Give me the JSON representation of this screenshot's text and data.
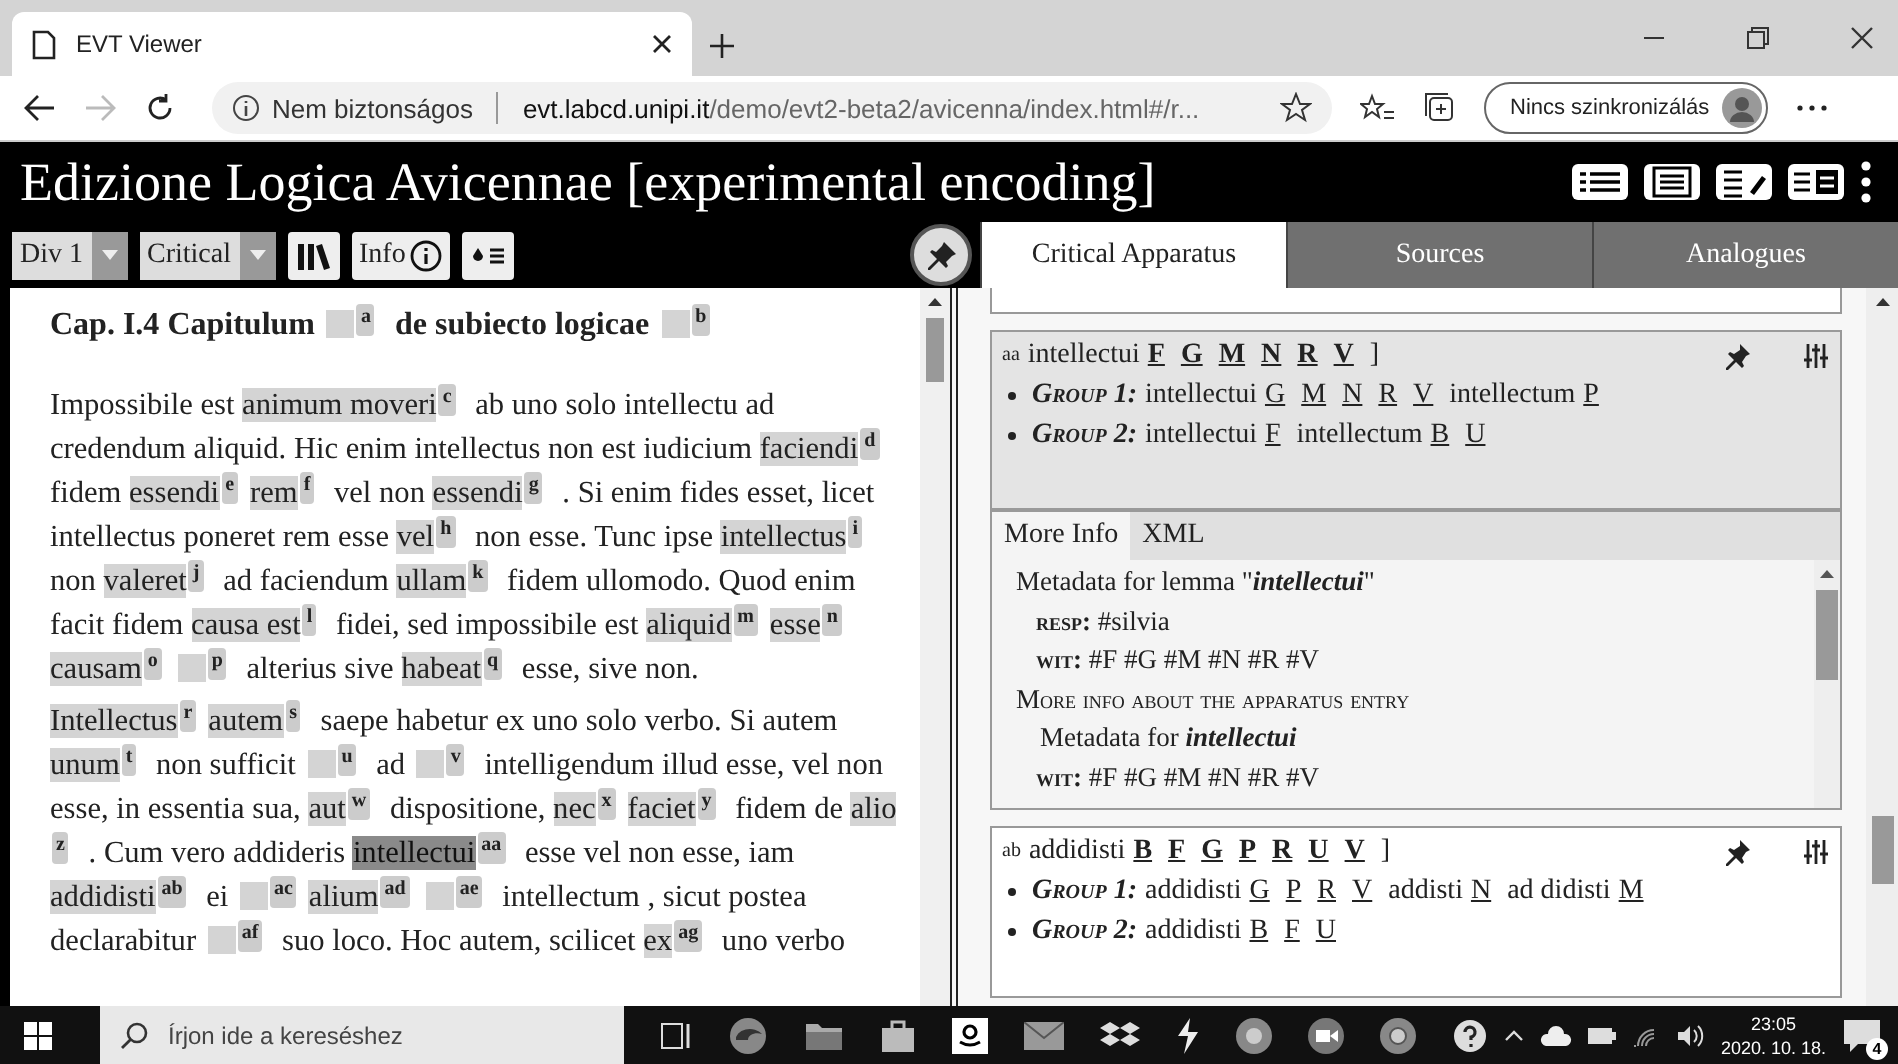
{
  "browser": {
    "tab_title": "EVT Viewer",
    "security": "Nem biztonságos",
    "url_host": "evt.labcd.unipi.it",
    "url_path": "/demo/evt2-beta2/avicenna/index.html#/r...",
    "forward_disabled": true,
    "profile": "Nincs szinkronizálás"
  },
  "app": {
    "title": "Edizione Logica Avicennae [experimental encoding]"
  },
  "toolbar": {
    "selects": [
      "Div 1",
      "Critical"
    ],
    "info_label": "Info"
  },
  "tabs": [
    {
      "label": "Critical Apparatus",
      "selected": true
    },
    {
      "label": "Sources",
      "selected": false
    },
    {
      "label": "Analogues",
      "selected": false
    }
  ],
  "text": {
    "heading": [
      {
        "kind": "text",
        "text": "Cap. I.4 Capitulum "
      },
      {
        "kind": "gap",
        "note": "a"
      },
      {
        "kind": "text",
        "text": " de subiecto logicae "
      },
      {
        "kind": "gap",
        "note": "b"
      }
    ],
    "paragraphs": [
      [
        {
          "kind": "text",
          "text": "Impossibile est "
        },
        {
          "kind": "reading",
          "text": "animum moveri",
          "note": "c",
          "selected": false
        },
        {
          "kind": "text",
          "text": " ab uno solo intellectu ad credendum aliquid. Hic enim intellectus non est iudicium "
        },
        {
          "kind": "reading",
          "text": "faciendi",
          "note": "d",
          "selected": false
        },
        {
          "kind": "text",
          "text": " fidem "
        },
        {
          "kind": "reading",
          "text": "essendi",
          "note": "e",
          "selected": false
        },
        {
          "kind": "reading",
          "text": "rem",
          "note": "f",
          "selected": false
        },
        {
          "kind": "text",
          "text": " vel non "
        },
        {
          "kind": "reading",
          "text": "essendi",
          "note": "g",
          "selected": false
        },
        {
          "kind": "text",
          "text": " . Si enim fides esset, licet intellectus poneret rem esse "
        },
        {
          "kind": "reading",
          "text": "vel",
          "note": "h",
          "selected": false
        },
        {
          "kind": "text",
          "text": " non esse. Tunc ipse "
        },
        {
          "kind": "reading",
          "text": "intellectus",
          "note": "i",
          "selected": false
        },
        {
          "kind": "text",
          "text": " non "
        },
        {
          "kind": "reading",
          "text": "valeret",
          "note": "j",
          "selected": false
        },
        {
          "kind": "text",
          "text": " ad faciendum "
        },
        {
          "kind": "reading",
          "text": "ullam",
          "note": "k",
          "selected": false
        },
        {
          "kind": "text",
          "text": " fidem ullomodo. Quod enim facit fidem "
        },
        {
          "kind": "reading",
          "text": "causa est",
          "note": "l",
          "selected": false
        },
        {
          "kind": "text",
          "text": " fidei, sed impossibile est "
        },
        {
          "kind": "reading",
          "text": "aliquid",
          "note": "m",
          "selected": false
        },
        {
          "kind": "reading",
          "text": "esse",
          "note": "n",
          "selected": false
        },
        {
          "kind": "reading",
          "text": "causam",
          "note": "o",
          "selected": false
        },
        {
          "kind": "gap",
          "note": "p"
        },
        {
          "kind": "text",
          "text": " alterius sive "
        },
        {
          "kind": "reading",
          "text": "habeat",
          "note": "q",
          "selected": false
        },
        {
          "kind": "text",
          "text": " esse, sive non."
        }
      ],
      [
        {
          "kind": "reading",
          "text": "Intellectus",
          "note": "r",
          "selected": false
        },
        {
          "kind": "reading",
          "text": "autem",
          "note": "s",
          "selected": false
        },
        {
          "kind": "text",
          "text": " saepe habetur ex uno solo verbo.  Si autem "
        },
        {
          "kind": "reading",
          "text": "unum",
          "note": "t",
          "selected": false
        },
        {
          "kind": "text",
          "text": " non sufficit "
        },
        {
          "kind": "gap",
          "note": "u"
        },
        {
          "kind": "text",
          "text": " ad "
        },
        {
          "kind": "gap",
          "note": "v"
        },
        {
          "kind": "text",
          "text": " intelligendum illud esse, vel non esse, in essentia sua, "
        },
        {
          "kind": "reading",
          "text": "aut",
          "note": "w",
          "selected": false
        },
        {
          "kind": "text",
          "text": " dispositione, "
        },
        {
          "kind": "reading",
          "text": "nec",
          "note": "x",
          "selected": false
        },
        {
          "kind": "reading",
          "text": "faciet",
          "note": "y",
          "selected": false
        },
        {
          "kind": "text",
          "text": " fidem de "
        },
        {
          "kind": "reading",
          "text": "alio",
          "note": "z",
          "selected": false
        },
        {
          "kind": "text",
          "text": " . Cum vero addideris "
        },
        {
          "kind": "reading",
          "text": "intellectui",
          "note": "aa",
          "selected": true
        },
        {
          "kind": "text",
          "text": " esse vel non esse, iam "
        },
        {
          "kind": "reading",
          "text": "addidisti",
          "note": "ab",
          "selected": false
        },
        {
          "kind": "text",
          "text": " ei "
        },
        {
          "kind": "gap",
          "note": "ac"
        },
        {
          "kind": "reading",
          "text": "alium",
          "note": "ad",
          "selected": false
        },
        {
          "kind": "gap",
          "note": "ae"
        },
        {
          "kind": "text",
          "text": " intellectum , sicut postea declarabitur "
        },
        {
          "kind": "gap",
          "note": "af"
        },
        {
          "kind": "text",
          "text": " suo loco. Hoc autem, scilicet "
        },
        {
          "kind": "reading",
          "text": "ex",
          "note": "ag",
          "selected": false
        },
        {
          "kind": "text",
          "text": " uno verbo"
        }
      ]
    ]
  },
  "apparatus": {
    "entries": [
      {
        "note": "aa",
        "lemma": "intellectui",
        "witnesses": [
          "F",
          "G",
          "M",
          "N",
          "R",
          "V"
        ],
        "bracket": "]",
        "selected": true,
        "groups": [
          {
            "label": "Group 1:",
            "readings": [
              {
                "text": "intellectui",
                "witnesses": [
                  "G",
                  "M",
                  "N",
                  "R",
                  "V"
                ]
              },
              {
                "text": "intellectum",
                "witnesses": [
                  "P"
                ]
              }
            ]
          },
          {
            "label": "Group 2:",
            "readings": [
              {
                "text": "intellectui",
                "witnesses": [
                  "F"
                ]
              },
              {
                "text": "intellectum",
                "witnesses": [
                  "B",
                  "U"
                ]
              }
            ]
          }
        ],
        "details": {
          "tabs": [
            {
              "label": "More Info",
              "selected": true
            },
            {
              "label": "XML",
              "selected": false
            }
          ],
          "lines": [
            {
              "kind": "heading",
              "text": "Metadata for lemma \"",
              "term": "intellectui",
              "after": "\""
            },
            {
              "kind": "field",
              "key": "resp:",
              "value": "#silvia"
            },
            {
              "kind": "field",
              "key": "wit:",
              "value": "#F #G #M #N #R #V"
            },
            {
              "kind": "section",
              "text": "More info about the apparatus entry"
            },
            {
              "kind": "heading",
              "text": "Metadata for ",
              "term": "intellectui"
            },
            {
              "kind": "field",
              "key": "wit:",
              "value": "#F #G #M #N #R #V"
            }
          ]
        }
      },
      {
        "note": "ab",
        "lemma": "addidisti",
        "witnesses": [
          "B",
          "F",
          "G",
          "P",
          "R",
          "U",
          "V"
        ],
        "bracket": "]",
        "selected": false,
        "groups": [
          {
            "label": "Group 1:",
            "readings": [
              {
                "text": "addidisti",
                "witnesses": [
                  "G",
                  "P",
                  "R",
                  "V"
                ]
              },
              {
                "text": "addisti",
                "witnesses": [
                  "N"
                ]
              },
              {
                "text": "ad didisti",
                "witnesses": [
                  "M"
                ]
              }
            ]
          },
          {
            "label": "Group 2:",
            "readings": [
              {
                "text": "addidisti",
                "witnesses": [
                  "B",
                  "F",
                  "U"
                ]
              }
            ]
          }
        ]
      }
    ]
  },
  "taskbar": {
    "search_placeholder": "Írjon ide a kereséshez",
    "time": "23:05",
    "date": "2020. 10. 18.",
    "notifications": "4"
  }
}
